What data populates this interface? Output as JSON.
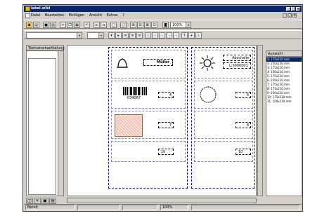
{
  "window": {
    "title": "label.wlbl",
    "controls": [
      "_",
      "□",
      "×"
    ]
  },
  "menu": {
    "items": [
      "Datei",
      "Bearbeiten",
      "Einfügen",
      "Ansicht",
      "Extras",
      "?"
    ],
    "mdi_controls": [
      "_",
      "□",
      "×"
    ]
  },
  "toolbar": {
    "zoom": "100%"
  },
  "left_panel": {
    "header": "Textverschachtelung"
  },
  "labels": {
    "cell1_text": "Müller",
    "cell2_text_top": "Abschalte",
    "cell2_text_bottom": "L:0000001",
    "barcode_number": "034067",
    "num_4": "4",
    "num_5": "5",
    "num_7": "7",
    "num_8": "8",
    "field_10a": "10",
    "field_10b": "10"
  },
  "right_panel": {
    "header": "Auswahl",
    "items": [
      "1: 175x210 mm",
      "2: 250x230 mm",
      "3: 175x210 mm",
      "4: 100x210 mm",
      "5: 175x210 mm",
      "6: 250x210 mm",
      "7: 275x210 mm",
      "8: 175x210 mm",
      "9: 250x210 mm",
      "10: 175x210 mm",
      "11: 100x210 mm"
    ]
  },
  "status": {
    "left": "Bereit",
    "pos": "",
    "zoom": "100%"
  }
}
